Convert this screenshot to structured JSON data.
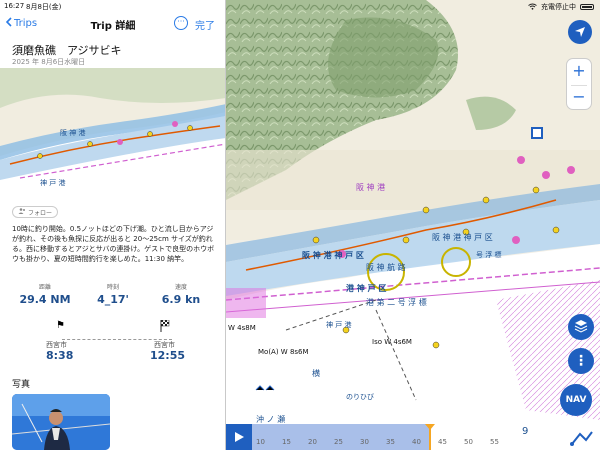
{
  "status": {
    "time": "16:27",
    "date": "8月8日(金)",
    "battery": "充電停止中"
  },
  "nav": {
    "back_label": "Trips",
    "title": "Trip 詳細",
    "more_icon": "ellipsis-circle-icon",
    "done_label": "完了"
  },
  "trip": {
    "title": "須磨魚礁　アジサビキ",
    "date": "2025 年 8月6日水曜日",
    "follow_label": "フォロー",
    "description": "10時に釣り開始。0.5ノットほどの下げ潮。ひと流し目からアジが釣れ、その後も魚探に反応が出ると 20～25cm サイズが釣れる。西に移動するとアジとサバの連掛け。ゲストで良型のホウボウも掛かり、夏の短時間釣行を楽しめた。11:30 納竿。"
  },
  "stats": [
    {
      "label": "距離",
      "value": "29.4 NM"
    },
    {
      "label": "時刻",
      "value": "4_17'"
    },
    {
      "label": "速度",
      "value": "6.9 kn"
    }
  ],
  "route": {
    "start_place": "西宮市",
    "start_time": "8:38",
    "end_place": "西宮市",
    "end_time": "12:55"
  },
  "photos_label": "写真",
  "map": {
    "labels": {
      "hanshin_a": "阪 神 港",
      "hanshin_b": "阪 神 港 神 戸 区",
      "hanshin_c": "阪 神 港 神 戸 区",
      "kobe": "神 戸 港",
      "kaisou": "阪 神 航 路",
      "ukiyo": "港 第 二 号 浮 標",
      "kobe_ku": "港 神 戸 区",
      "yoko": "横",
      "okinose": "沖 ノ 瀬",
      "norihibi": "のりひび",
      "ukiyo2": "号 浮 標",
      "light_a": "W 4s8M",
      "light_b": "Mo(A) W 8s6M",
      "light_c": "Iso W 4s6M",
      "mini_a": "阪 神 港",
      "mini_b": "神 戸 港"
    },
    "nav_label": "NAV",
    "icons": {
      "locate": "location-arrow-icon",
      "layers": "layers-icon",
      "more": "more-vertical-icon",
      "tools": "measure-tools-icon"
    }
  },
  "timeline": {
    "ticks": [
      "10",
      "15",
      "20",
      "25",
      "30",
      "35",
      "40",
      "45",
      "50",
      "55"
    ],
    "progress": 0.59,
    "current_label": "9"
  }
}
